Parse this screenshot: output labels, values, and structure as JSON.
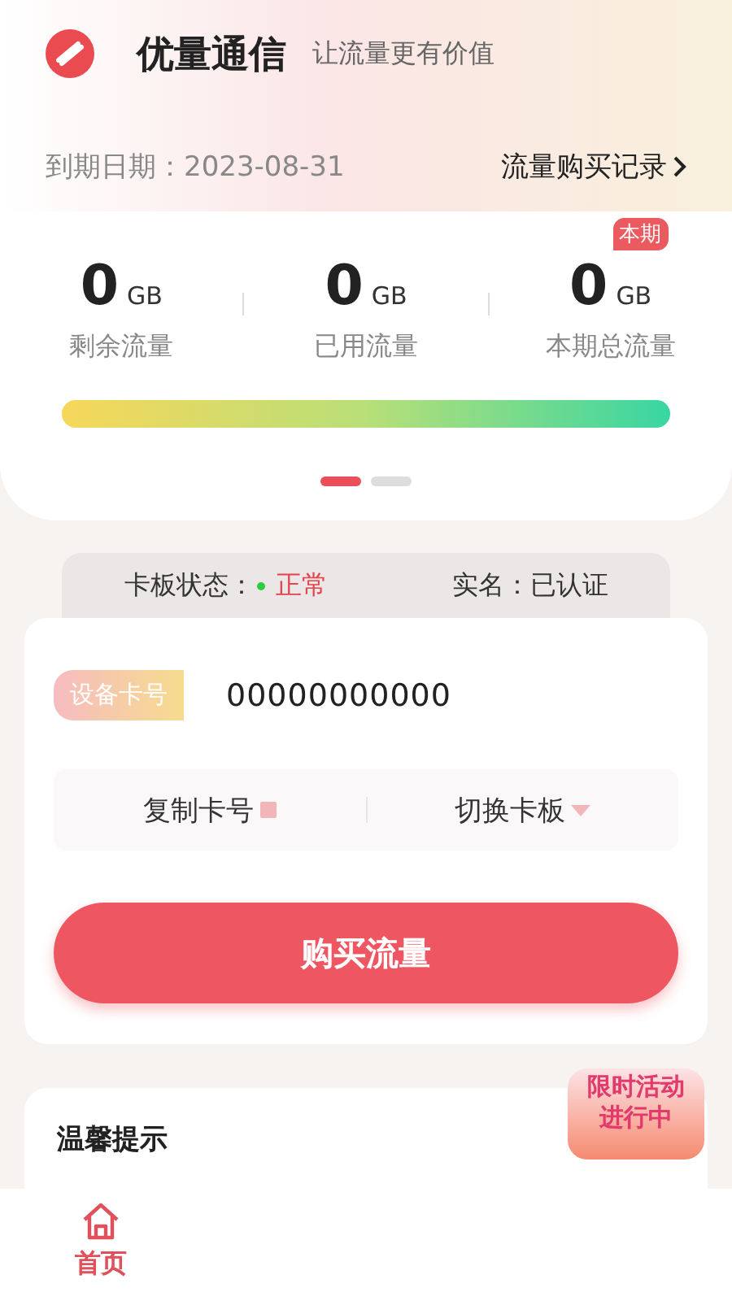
{
  "header": {
    "app_name": "优量通信",
    "slogan": "让流量更有价值",
    "expiry_label": "到期日期：",
    "expiry_date": "2023-08-31",
    "record_link": "流量购买记录"
  },
  "stats": [
    {
      "value": "0",
      "unit": "GB",
      "label": "剩余流量"
    },
    {
      "value": "0",
      "unit": "GB",
      "label": "已用流量"
    },
    {
      "value": "0",
      "unit": "GB",
      "label": "本期总流量",
      "badge": "本期"
    }
  ],
  "usage_bar": {
    "level": 1
  },
  "pager": [
    {
      "selected": true
    },
    {
      "selected": false
    }
  ],
  "status": {
    "card_label": "卡板状态：",
    "card_state": "正常",
    "color": "#2ecc40",
    "realname_label": "实名：",
    "realname_value": "已认证"
  },
  "card": {
    "number_label": "设备卡号",
    "number": "00000000000",
    "copy_button": "复制卡号",
    "switch_button": "切换卡板",
    "buy_button": "购买流量"
  },
  "tips": {
    "title": "温馨提示"
  },
  "promo": {
    "line_1": "限时活动",
    "line_2": "进行中"
  },
  "nav": [
    {
      "label": "首页",
      "selected": true
    }
  ]
}
